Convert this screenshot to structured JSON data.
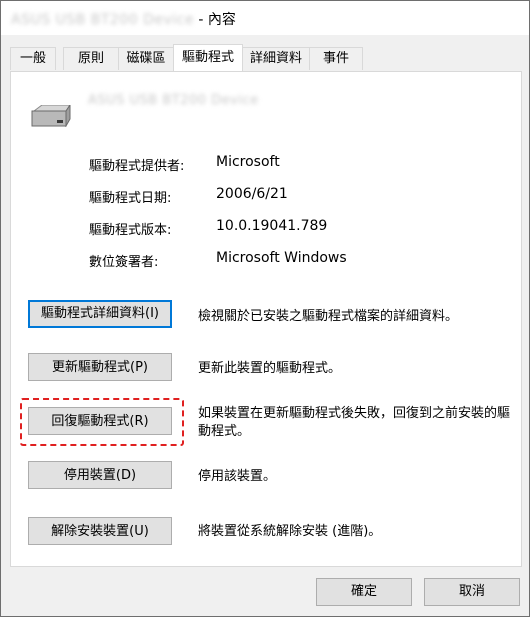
{
  "window": {
    "title_blurred": "ASUS USB BT200 Device",
    "title_suffix": "- 內容"
  },
  "tabs": [
    {
      "label": "一般",
      "active": false
    },
    {
      "label": "原則",
      "active": false
    },
    {
      "label": "磁碟區",
      "active": false
    },
    {
      "label": "驅動程式",
      "active": true
    },
    {
      "label": "詳細資料",
      "active": false
    },
    {
      "label": "事件",
      "active": false
    }
  ],
  "device": {
    "icon": "drive-icon",
    "name_blurred": "ASUS USB BT200 Device"
  },
  "info": [
    {
      "label": "驅動程式提供者:",
      "value": "Microsoft"
    },
    {
      "label": "驅動程式日期:",
      "value": "2006/6/21"
    },
    {
      "label": "驅動程式版本:",
      "value": "10.0.19041.789"
    },
    {
      "label": "數位簽署者:",
      "value": "Microsoft Windows"
    }
  ],
  "actions": [
    {
      "button": "驅動程式詳細資料(I)",
      "description": "檢視關於已安裝之驅動程式檔案的詳細資料。"
    },
    {
      "button": "更新驅動程式(P)",
      "description": "更新此裝置的驅動程式。"
    },
    {
      "button": "回復驅動程式(R)",
      "description": "如果裝置在更新驅動程式後失敗，回復到之前安裝的驅動程式。"
    },
    {
      "button": "停用裝置(D)",
      "description": "停用該裝置。"
    },
    {
      "button": "解除安裝裝置(U)",
      "description": "將裝置從系統解除安裝 (進階)。"
    }
  ],
  "footer": {
    "ok": "確定",
    "cancel": "取消"
  },
  "colors": {
    "focus_border": "#0078d7",
    "highlight": "#e02020"
  }
}
